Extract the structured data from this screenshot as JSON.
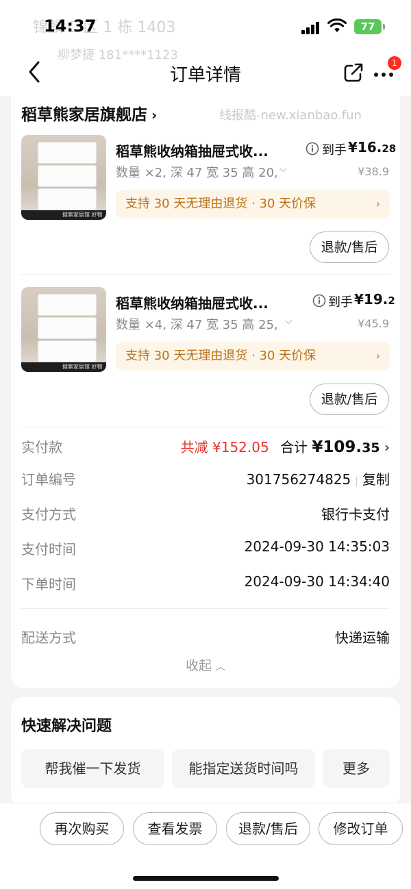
{
  "status_bar": {
    "time": "14:37",
    "battery": "77"
  },
  "background_address": {
    "line1": "锦麟 C 区 1 栋 1403",
    "line2": "柳梦捷  181****1123"
  },
  "nav": {
    "title": "订单详情",
    "notification_count": "1"
  },
  "shop": {
    "name": "稻草熊家居旗舰店",
    "chevron": "›"
  },
  "watermark": "线报酷-new.xianbao.fun",
  "products": [
    {
      "title": "稻草熊收纳箱抽屉式收...",
      "price_label": "到手",
      "price_main": "¥16.",
      "price_decimal": "28",
      "spec": "数量 ×2, 深 47 宽 35 高 20, 【",
      "original_price": "¥38.9",
      "guarantee": "支持 30 天无理由退货 · 30 天价保",
      "refund_label": "退款/售后"
    },
    {
      "title": "稻草熊收纳箱抽屉式收...",
      "price_label": "到手",
      "price_main": "¥19.",
      "price_decimal": "2",
      "spec": "数量 ×4, 深 47 宽 35 高 25, 【",
      "original_price": "¥45.9",
      "guarantee": "支持 30 天无理由退货 · 30 天价保",
      "refund_label": "退款/售后"
    }
  ],
  "thumb_footer_text": "搜索家居馆 好物享5折",
  "payment": {
    "label": "实付款",
    "discount": "共减 ¥152.05",
    "total_label": "合计",
    "total_main": "¥109.",
    "total_decimal": "35"
  },
  "order_info": {
    "order_no_label": "订单编号",
    "order_no": "301756274825",
    "copy_label": "复制",
    "pay_method_label": "支付方式",
    "pay_method": "银行卡支付",
    "pay_time_label": "支付时间",
    "pay_time": "2024-09-30 14:35:03",
    "order_time_label": "下单时间",
    "order_time": "2024-09-30 14:34:40",
    "delivery_label": "配送方式",
    "delivery": "快递运输",
    "collapse_label": "收起"
  },
  "quick": {
    "title": "快速解决问题",
    "chips": [
      "帮我催一下发货",
      "能指定送货时间吗",
      "更多"
    ]
  },
  "bottom_actions": [
    "再次购买",
    "查看发票",
    "退款/售后",
    "修改订单"
  ],
  "colors": {
    "accent_red": "#e6332a",
    "guarantee_bg": "#fdf5e8",
    "guarantee_text": "#b8741a",
    "battery_green": "#5ac85a"
  }
}
